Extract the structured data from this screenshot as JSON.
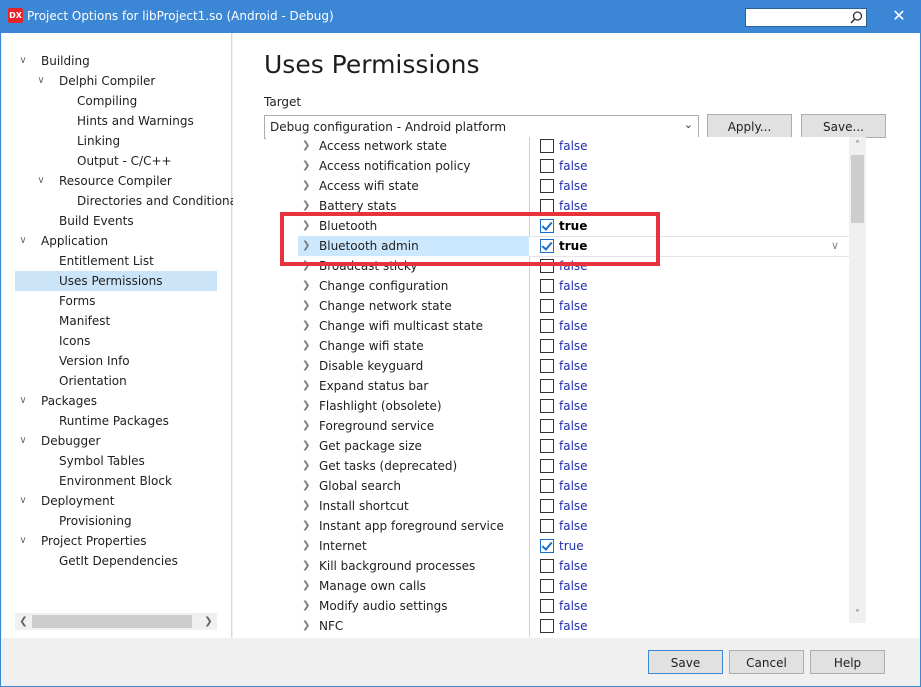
{
  "window": {
    "title": "Project Options for libProject1.so  (Android - Debug)",
    "app_icon": "DX",
    "close_glyph": "✕",
    "accent": "#3b87d6"
  },
  "tree": {
    "items": [
      {
        "label": "Building",
        "expandable": true
      },
      {
        "label": "Delphi Compiler",
        "expandable": true
      },
      {
        "label": "Compiling"
      },
      {
        "label": "Hints and Warnings"
      },
      {
        "label": "Linking"
      },
      {
        "label": "Output - C/C++"
      },
      {
        "label": "Resource Compiler",
        "expandable": true
      },
      {
        "label": "Directories and Conditiona"
      },
      {
        "label": "Build Events"
      },
      {
        "label": "Application",
        "expandable": true
      },
      {
        "label": "Entitlement List"
      },
      {
        "label": "Uses Permissions",
        "selected": true
      },
      {
        "label": "Forms"
      },
      {
        "label": "Manifest"
      },
      {
        "label": "Icons"
      },
      {
        "label": "Version Info"
      },
      {
        "label": "Orientation"
      },
      {
        "label": "Packages",
        "expandable": true
      },
      {
        "label": "Runtime Packages"
      },
      {
        "label": "Debugger",
        "expandable": true
      },
      {
        "label": "Symbol Tables"
      },
      {
        "label": "Environment Block"
      },
      {
        "label": "Deployment",
        "expandable": true
      },
      {
        "label": "Provisioning"
      },
      {
        "label": "Project Properties",
        "expandable": true
      },
      {
        "label": "GetIt Dependencies"
      }
    ]
  },
  "main": {
    "title": "Uses Permissions",
    "target_label": "Target",
    "target_value": "Debug configuration - Android platform",
    "apply_label": "Apply...",
    "save_label": "Save..."
  },
  "permissions": [
    {
      "name": "Access network state",
      "value": "false",
      "checked": false
    },
    {
      "name": "Access notification policy",
      "value": "false",
      "checked": false
    },
    {
      "name": "Access wifi state",
      "value": "false",
      "checked": false
    },
    {
      "name": "Battery stats",
      "value": "false",
      "checked": false
    },
    {
      "name": "Bluetooth",
      "value": "true",
      "checked": true,
      "bold": true
    },
    {
      "name": "Bluetooth admin",
      "value": "true",
      "checked": true,
      "bold": true,
      "selected": true
    },
    {
      "name": "Broadcast sticky",
      "value": "false",
      "checked": false
    },
    {
      "name": "Change configuration",
      "value": "false",
      "checked": false
    },
    {
      "name": "Change network state",
      "value": "false",
      "checked": false
    },
    {
      "name": "Change wifi multicast state",
      "value": "false",
      "checked": false
    },
    {
      "name": "Change wifi state",
      "value": "false",
      "checked": false
    },
    {
      "name": "Disable keyguard",
      "value": "false",
      "checked": false
    },
    {
      "name": "Expand status bar",
      "value": "false",
      "checked": false
    },
    {
      "name": "Flashlight (obsolete)",
      "value": "false",
      "checked": false
    },
    {
      "name": "Foreground service",
      "value": "false",
      "checked": false
    },
    {
      "name": "Get package size",
      "value": "false",
      "checked": false
    },
    {
      "name": "Get tasks (deprecated)",
      "value": "false",
      "checked": false
    },
    {
      "name": "Global search",
      "value": "false",
      "checked": false
    },
    {
      "name": "Install shortcut",
      "value": "false",
      "checked": false
    },
    {
      "name": "Instant app foreground service",
      "value": "false",
      "checked": false
    },
    {
      "name": "Internet",
      "value": "true",
      "checked": true
    },
    {
      "name": "Kill background processes",
      "value": "false",
      "checked": false
    },
    {
      "name": "Manage own calls",
      "value": "false",
      "checked": false
    },
    {
      "name": "Modify audio settings",
      "value": "false",
      "checked": false
    },
    {
      "name": "NFC",
      "value": "false",
      "checked": false
    }
  ],
  "footer": {
    "save_label": "Save",
    "cancel_label": "Cancel",
    "help_label": "Help"
  },
  "colors": {
    "highlight": "#e8333c",
    "selection": "#cce4f7",
    "false_text": "#1f2db0"
  }
}
